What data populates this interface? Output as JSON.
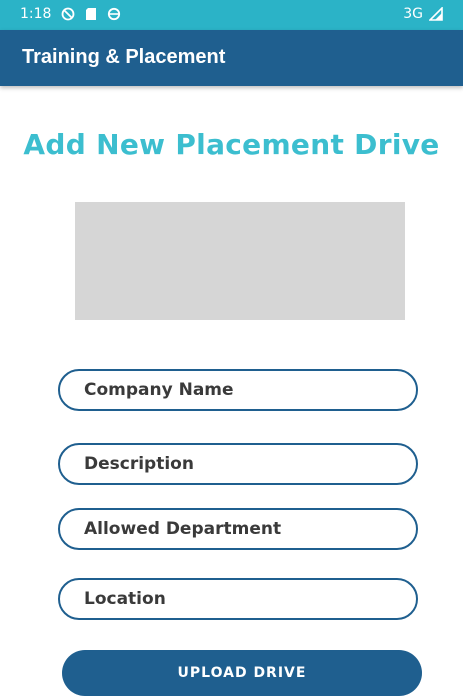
{
  "status_bar": {
    "time": "1:18",
    "network": "3G",
    "icons": [
      "do-not-disturb-icon",
      "sd-card-icon",
      "sync-icon",
      "signal-icon"
    ]
  },
  "app_bar": {
    "title": "Training & Placement"
  },
  "page": {
    "heading": "Add New Placement Drive"
  },
  "form": {
    "company_name_placeholder": "Company Name",
    "description_placeholder": "Description",
    "allowed_department_placeholder": "Allowed Department",
    "location_placeholder": "Location",
    "upload_label": "UPLOAD DRIVE"
  },
  "colors": {
    "status_bar": "#2bb3c7",
    "app_bar": "#1f5f8f",
    "heading": "#3cbecf",
    "placeholder_box": "#d6d6d6"
  }
}
